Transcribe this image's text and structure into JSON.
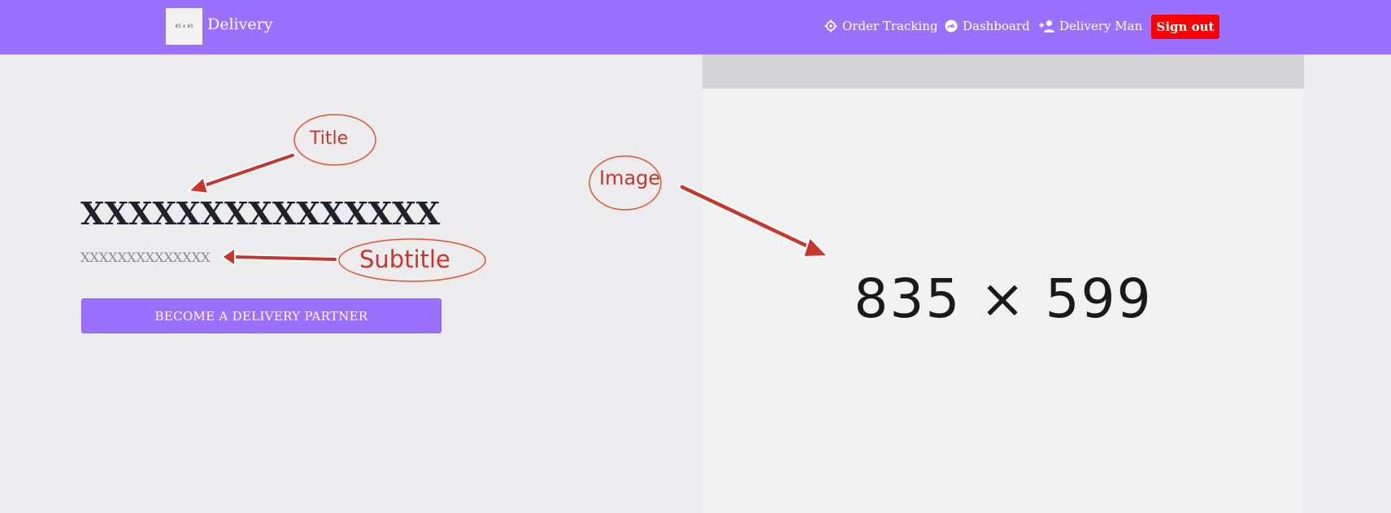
{
  "navbar": {
    "logo_text": "45 x 45",
    "brand": "Delivery",
    "links": [
      {
        "label": "Order Tracking",
        "icon": "crosshair-icon"
      },
      {
        "label": "Dashboard",
        "icon": "gauge-icon"
      },
      {
        "label": "Delivery Man",
        "icon": "person-add-icon"
      }
    ],
    "signout_label": "Sign out"
  },
  "hero": {
    "title": "XXXXXXXXXXXXXXX",
    "subtitle": "XXXXXXXXXXXXXX",
    "cta_label": "BECOME A DELIVERY PARTNER"
  },
  "image_placeholder": {
    "dimensions_text": "835 × 599"
  },
  "annotations": {
    "title": "Title",
    "subtitle": "Subtitle",
    "image": "Image"
  },
  "colors": {
    "primary": "#9b70ff",
    "signout": "#ff0000",
    "annotation": "#c8352a",
    "background": "#ecebee"
  }
}
